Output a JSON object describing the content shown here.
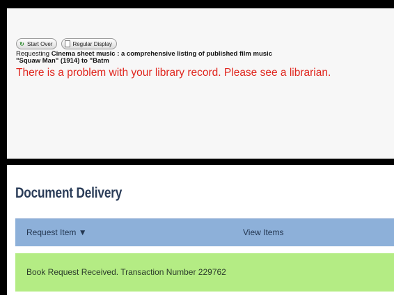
{
  "toolbar": {
    "start_over_label": "Start Over",
    "regular_display_label": "Regular Display"
  },
  "request": {
    "prefix": "Requesting ",
    "title_line1": "Cinema sheet music : a comprehensive listing of published film music",
    "title_line2": "\"Squaw Man\" (1914) to \"Batm"
  },
  "error_message": "There is a problem with your library record. Please see a librarian.",
  "document_delivery": {
    "title": "Document Delivery",
    "tabs": [
      {
        "label": "Request Item ▼"
      },
      {
        "label": "View Items"
      }
    ],
    "status_message": "Book Request Received. Transaction Number 229762",
    "colors": {
      "tab_bar": "#8db0d9",
      "success": "#b4ec84",
      "error": "#e0251d",
      "title": "#2a3c58"
    }
  },
  "icons": {
    "start_over": "refresh-icon",
    "regular_display": "document-icon"
  }
}
